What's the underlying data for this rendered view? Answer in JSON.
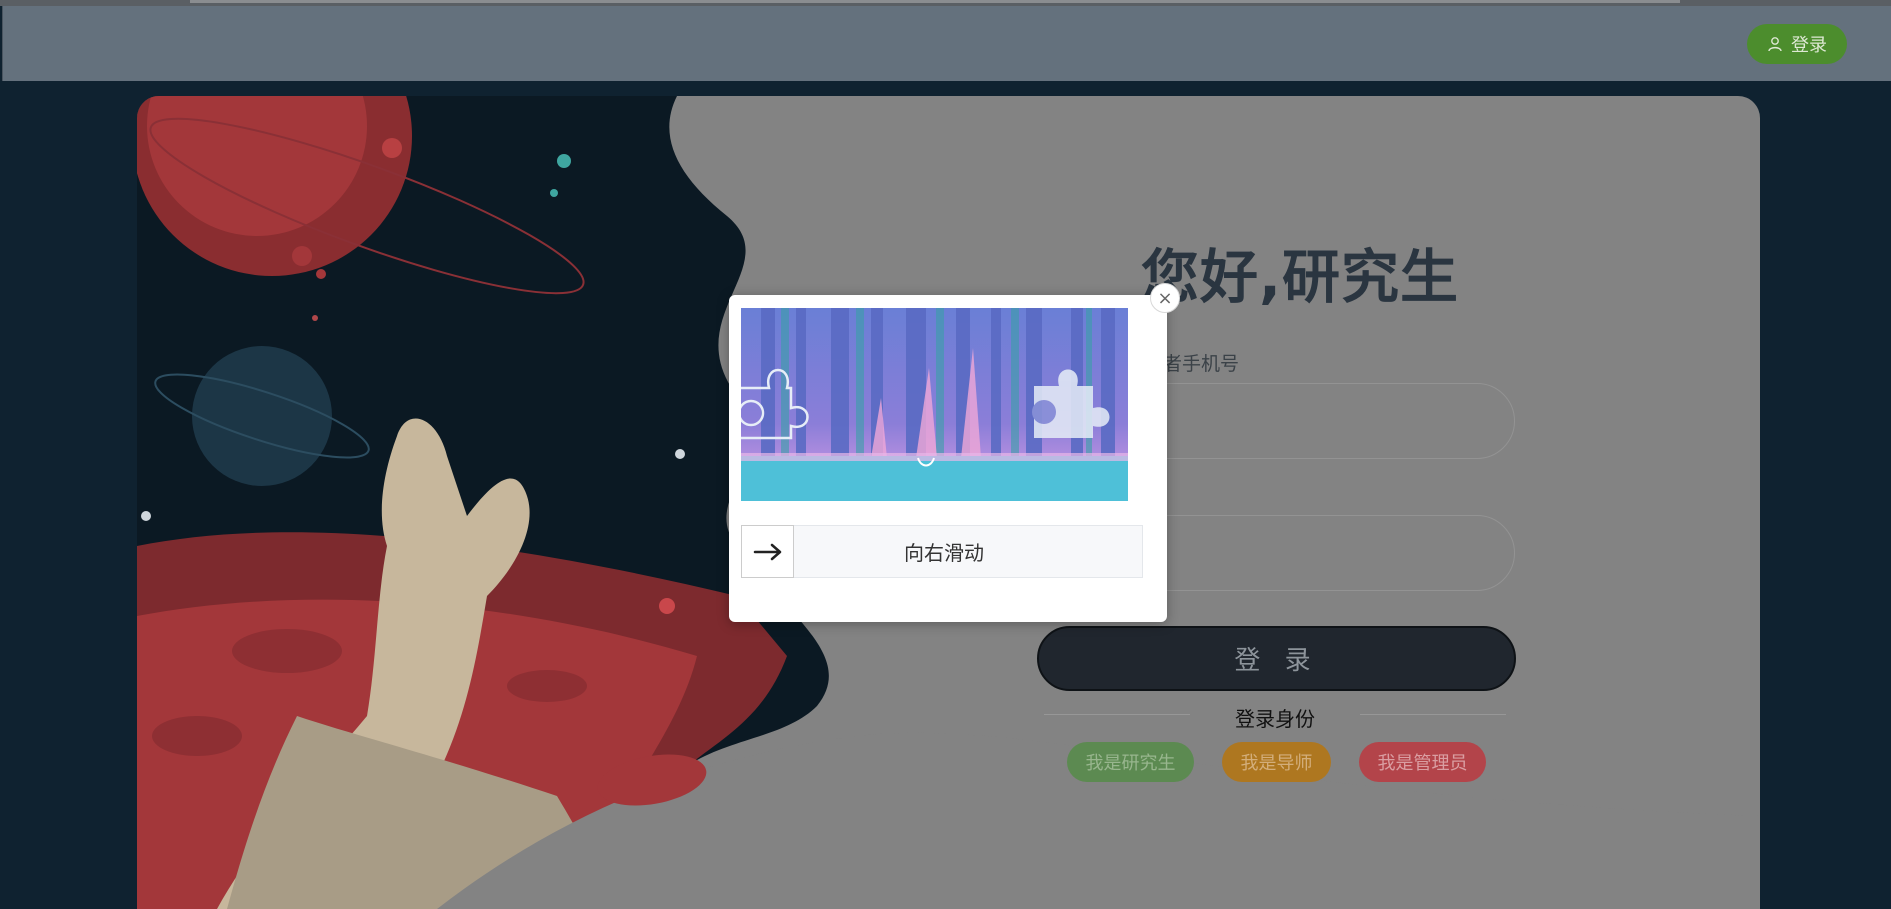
{
  "header": {
    "login_label": "登录"
  },
  "login_form": {
    "title": "您好,研究生",
    "account_label_visible": "者手机号",
    "submit_label": "登 录",
    "role_title": "登录身份",
    "roles": [
      {
        "label": "我是研究生",
        "color": "#5c8a51"
      },
      {
        "label": "我是导师",
        "color": "#ae7720"
      },
      {
        "label": "我是管理员",
        "color": "#b3444a"
      }
    ]
  },
  "captcha": {
    "slider_text": "向右滑动",
    "close_symbol": "×"
  },
  "colors": {
    "header_bg": "#64717d",
    "login_button": "#4c8d2d",
    "card_bg": "#838383",
    "space_bg": "#0b1923",
    "planet_red": "#a3373a",
    "submit_bg": "#20262e"
  }
}
